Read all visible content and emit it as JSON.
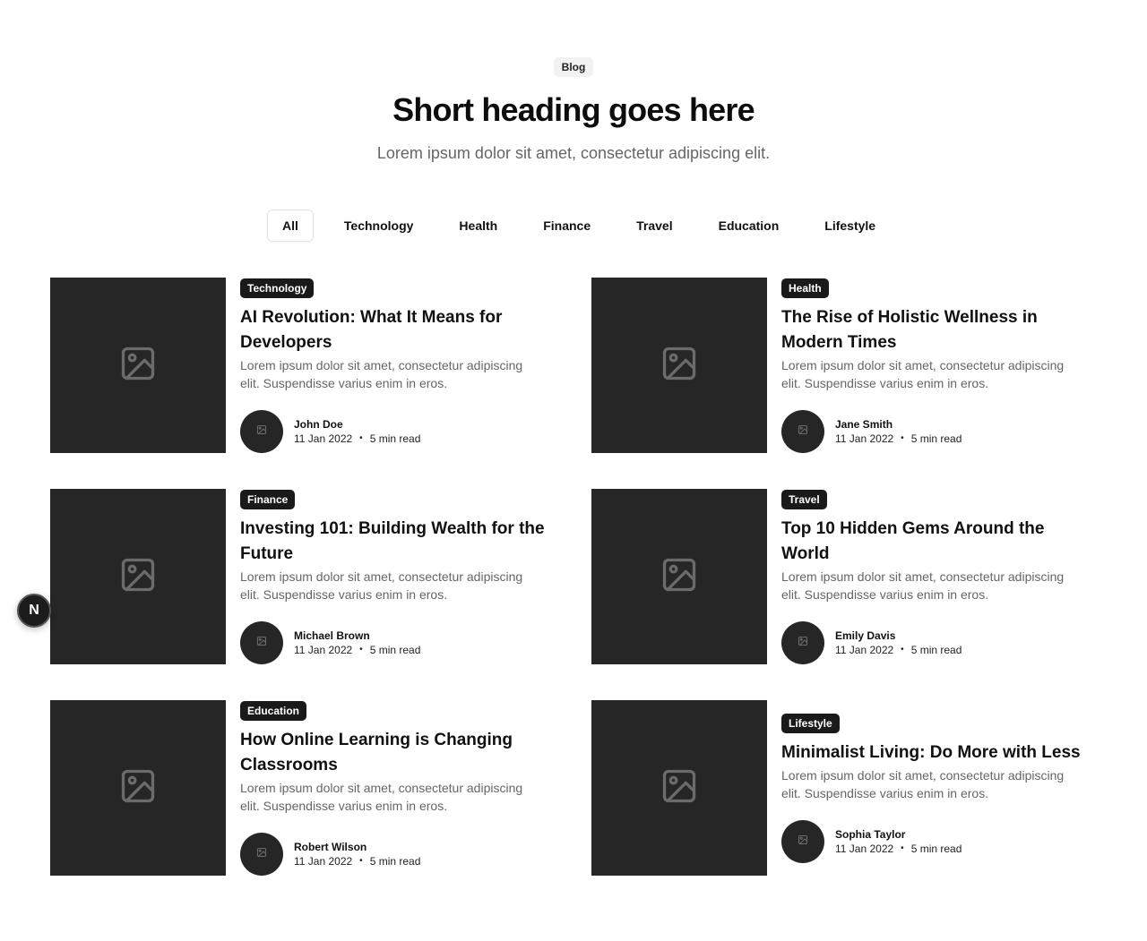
{
  "header": {
    "badge": "Blog",
    "title": "Short heading goes here",
    "subtitle": "Lorem ipsum dolor sit amet, consectetur adipiscing elit."
  },
  "tabs": [
    {
      "label": "All",
      "active": true
    },
    {
      "label": "Technology",
      "active": false
    },
    {
      "label": "Health",
      "active": false
    },
    {
      "label": "Finance",
      "active": false
    },
    {
      "label": "Travel",
      "active": false
    },
    {
      "label": "Education",
      "active": false
    },
    {
      "label": "Lifestyle",
      "active": false
    }
  ],
  "posts": [
    {
      "category": "Technology",
      "title": "AI Revolution: What It Means for Developers",
      "excerpt": "Lorem ipsum dolor sit amet, consectetur adipiscing elit. Suspendisse varius enim in eros.",
      "author": "John Doe",
      "date": "11 Jan 2022",
      "separator": "•",
      "read_time": "5 min read"
    },
    {
      "category": "Health",
      "title": "The Rise of Holistic Wellness in Modern Times",
      "excerpt": "Lorem ipsum dolor sit amet, consectetur adipiscing elit. Suspendisse varius enim in eros.",
      "author": "Jane Smith",
      "date": "11 Jan 2022",
      "separator": "•",
      "read_time": "5 min read"
    },
    {
      "category": "Finance",
      "title": "Investing 101: Building Wealth for the Future",
      "excerpt": "Lorem ipsum dolor sit amet, consectetur adipiscing elit. Suspendisse varius enim in eros.",
      "author": "Michael Brown",
      "date": "11 Jan 2022",
      "separator": "•",
      "read_time": "5 min read"
    },
    {
      "category": "Travel",
      "title": "Top 10 Hidden Gems Around the World",
      "excerpt": "Lorem ipsum dolor sit amet, consectetur adipiscing elit. Suspendisse varius enim in eros.",
      "author": "Emily Davis",
      "date": "11 Jan 2022",
      "separator": "•",
      "read_time": "5 min read"
    },
    {
      "category": "Education",
      "title": "How Online Learning is Changing Classrooms",
      "excerpt": "Lorem ipsum dolor sit amet, consectetur adipiscing elit. Suspendisse varius enim in eros.",
      "author": "Robert Wilson",
      "date": "11 Jan 2022",
      "separator": "•",
      "read_time": "5 min read"
    },
    {
      "category": "Lifestyle",
      "title": "Minimalist Living: Do More with Less",
      "excerpt": "Lorem ipsum dolor sit amet, consectetur adipiscing elit. Suspendisse varius enim in eros.",
      "author": "Sophia Taylor",
      "date": "11 Jan 2022",
      "separator": "•",
      "read_time": "5 min read"
    }
  ],
  "floating_button": {
    "label": "N"
  },
  "icons": {
    "thumbnail": "image-placeholder-icon",
    "avatar": "image-placeholder-icon"
  },
  "colors": {
    "thumbnail_bg": "#262626",
    "tag_bg": "#1a1a1a",
    "text": "#111111",
    "muted": "#666666"
  }
}
